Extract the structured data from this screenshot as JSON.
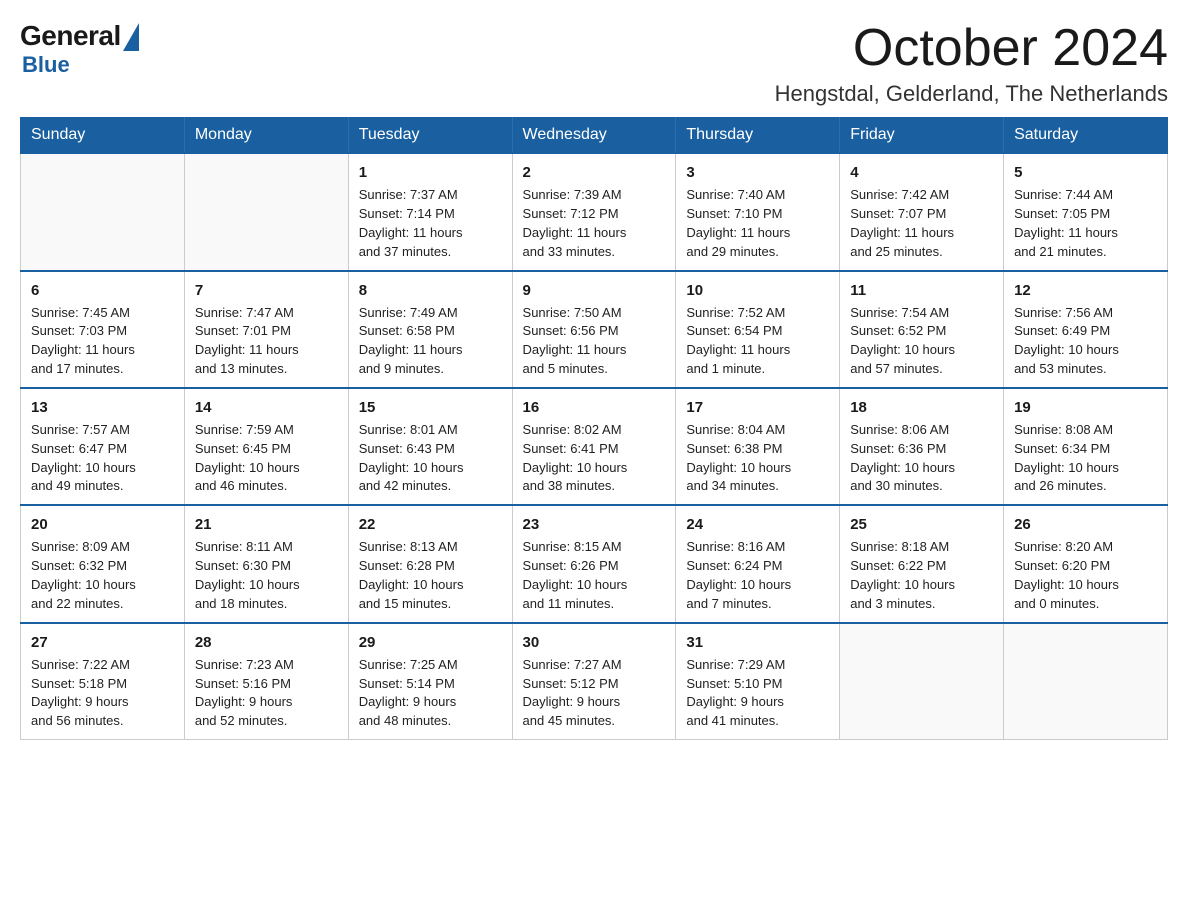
{
  "logo": {
    "general": "General",
    "blue": "Blue"
  },
  "title": "October 2024",
  "subtitle": "Hengstdal, Gelderland, The Netherlands",
  "header": {
    "days": [
      "Sunday",
      "Monday",
      "Tuesday",
      "Wednesday",
      "Thursday",
      "Friday",
      "Saturday"
    ]
  },
  "weeks": [
    [
      {
        "day": "",
        "info": ""
      },
      {
        "day": "",
        "info": ""
      },
      {
        "day": "1",
        "info": "Sunrise: 7:37 AM\nSunset: 7:14 PM\nDaylight: 11 hours\nand 37 minutes."
      },
      {
        "day": "2",
        "info": "Sunrise: 7:39 AM\nSunset: 7:12 PM\nDaylight: 11 hours\nand 33 minutes."
      },
      {
        "day": "3",
        "info": "Sunrise: 7:40 AM\nSunset: 7:10 PM\nDaylight: 11 hours\nand 29 minutes."
      },
      {
        "day": "4",
        "info": "Sunrise: 7:42 AM\nSunset: 7:07 PM\nDaylight: 11 hours\nand 25 minutes."
      },
      {
        "day": "5",
        "info": "Sunrise: 7:44 AM\nSunset: 7:05 PM\nDaylight: 11 hours\nand 21 minutes."
      }
    ],
    [
      {
        "day": "6",
        "info": "Sunrise: 7:45 AM\nSunset: 7:03 PM\nDaylight: 11 hours\nand 17 minutes."
      },
      {
        "day": "7",
        "info": "Sunrise: 7:47 AM\nSunset: 7:01 PM\nDaylight: 11 hours\nand 13 minutes."
      },
      {
        "day": "8",
        "info": "Sunrise: 7:49 AM\nSunset: 6:58 PM\nDaylight: 11 hours\nand 9 minutes."
      },
      {
        "day": "9",
        "info": "Sunrise: 7:50 AM\nSunset: 6:56 PM\nDaylight: 11 hours\nand 5 minutes."
      },
      {
        "day": "10",
        "info": "Sunrise: 7:52 AM\nSunset: 6:54 PM\nDaylight: 11 hours\nand 1 minute."
      },
      {
        "day": "11",
        "info": "Sunrise: 7:54 AM\nSunset: 6:52 PM\nDaylight: 10 hours\nand 57 minutes."
      },
      {
        "day": "12",
        "info": "Sunrise: 7:56 AM\nSunset: 6:49 PM\nDaylight: 10 hours\nand 53 minutes."
      }
    ],
    [
      {
        "day": "13",
        "info": "Sunrise: 7:57 AM\nSunset: 6:47 PM\nDaylight: 10 hours\nand 49 minutes."
      },
      {
        "day": "14",
        "info": "Sunrise: 7:59 AM\nSunset: 6:45 PM\nDaylight: 10 hours\nand 46 minutes."
      },
      {
        "day": "15",
        "info": "Sunrise: 8:01 AM\nSunset: 6:43 PM\nDaylight: 10 hours\nand 42 minutes."
      },
      {
        "day": "16",
        "info": "Sunrise: 8:02 AM\nSunset: 6:41 PM\nDaylight: 10 hours\nand 38 minutes."
      },
      {
        "day": "17",
        "info": "Sunrise: 8:04 AM\nSunset: 6:38 PM\nDaylight: 10 hours\nand 34 minutes."
      },
      {
        "day": "18",
        "info": "Sunrise: 8:06 AM\nSunset: 6:36 PM\nDaylight: 10 hours\nand 30 minutes."
      },
      {
        "day": "19",
        "info": "Sunrise: 8:08 AM\nSunset: 6:34 PM\nDaylight: 10 hours\nand 26 minutes."
      }
    ],
    [
      {
        "day": "20",
        "info": "Sunrise: 8:09 AM\nSunset: 6:32 PM\nDaylight: 10 hours\nand 22 minutes."
      },
      {
        "day": "21",
        "info": "Sunrise: 8:11 AM\nSunset: 6:30 PM\nDaylight: 10 hours\nand 18 minutes."
      },
      {
        "day": "22",
        "info": "Sunrise: 8:13 AM\nSunset: 6:28 PM\nDaylight: 10 hours\nand 15 minutes."
      },
      {
        "day": "23",
        "info": "Sunrise: 8:15 AM\nSunset: 6:26 PM\nDaylight: 10 hours\nand 11 minutes."
      },
      {
        "day": "24",
        "info": "Sunrise: 8:16 AM\nSunset: 6:24 PM\nDaylight: 10 hours\nand 7 minutes."
      },
      {
        "day": "25",
        "info": "Sunrise: 8:18 AM\nSunset: 6:22 PM\nDaylight: 10 hours\nand 3 minutes."
      },
      {
        "day": "26",
        "info": "Sunrise: 8:20 AM\nSunset: 6:20 PM\nDaylight: 10 hours\nand 0 minutes."
      }
    ],
    [
      {
        "day": "27",
        "info": "Sunrise: 7:22 AM\nSunset: 5:18 PM\nDaylight: 9 hours\nand 56 minutes."
      },
      {
        "day": "28",
        "info": "Sunrise: 7:23 AM\nSunset: 5:16 PM\nDaylight: 9 hours\nand 52 minutes."
      },
      {
        "day": "29",
        "info": "Sunrise: 7:25 AM\nSunset: 5:14 PM\nDaylight: 9 hours\nand 48 minutes."
      },
      {
        "day": "30",
        "info": "Sunrise: 7:27 AM\nSunset: 5:12 PM\nDaylight: 9 hours\nand 45 minutes."
      },
      {
        "day": "31",
        "info": "Sunrise: 7:29 AM\nSunset: 5:10 PM\nDaylight: 9 hours\nand 41 minutes."
      },
      {
        "day": "",
        "info": ""
      },
      {
        "day": "",
        "info": ""
      }
    ]
  ]
}
